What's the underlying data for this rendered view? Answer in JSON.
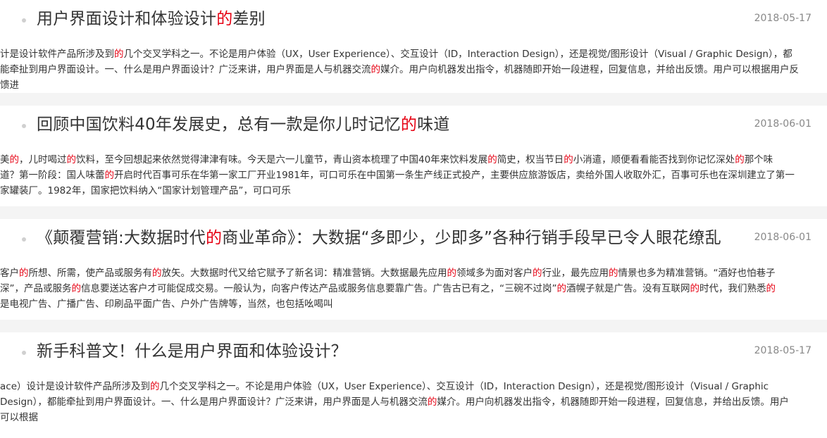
{
  "articles": [
    {
      "title_parts": [
        {
          "t": "用户界面设计和体验设计"
        },
        {
          "t": "的",
          "hl": true
        },
        {
          "t": "差别"
        }
      ],
      "date": "2018-05-17",
      "excerpt_lines": [
        [
          {
            "t": "计是设计软件产品所涉及到"
          },
          {
            "t": "的",
            "hl": true
          },
          {
            "t": "几个交叉学科之一。不论是用户体验（UX，User Experience）、交互设计（ID，Interaction Design），还是视觉/图形设计（Visual / Graphic Design），都"
          }
        ],
        [
          {
            "t": "能牵扯到用户界面设计。一、什么是用户界面设计？广泛来讲，用户界面是人与机器交流"
          },
          {
            "t": "的",
            "hl": true
          },
          {
            "t": "媒介。用户向机器发出指令，机器随即开始一段进程，回复信息，并给出反馈。用户可以根据用户反"
          }
        ],
        [
          {
            "t": "馈进"
          }
        ]
      ]
    },
    {
      "title_parts": [
        {
          "t": "回顾中国饮料40年发展史，总有一款是你儿时记忆"
        },
        {
          "t": "的",
          "hl": true
        },
        {
          "t": "味道"
        }
      ],
      "date": "2018-06-01",
      "excerpt_lines": [
        [
          {
            "t": "美"
          },
          {
            "t": "的",
            "hl": true
          },
          {
            "t": "，儿时喝过"
          },
          {
            "t": "的",
            "hl": true
          },
          {
            "t": "饮料，至今回想起来依然觉得津津有味。今天是六一儿童节，青山资本梳理了中国40年来饮料发展"
          },
          {
            "t": "的",
            "hl": true
          },
          {
            "t": "简史，权当节日"
          },
          {
            "t": "的",
            "hl": true
          },
          {
            "t": "小消遣，顺便看看能否找到你记忆深处"
          },
          {
            "t": "的",
            "hl": true
          },
          {
            "t": "那个味"
          }
        ],
        [
          {
            "t": "道？第一阶段：国人味蕾"
          },
          {
            "t": "的",
            "hl": true
          },
          {
            "t": "开启时代百事可乐在华第一家工厂开业1981年，可口可乐在中国第一条生产线正式投产，主要供应旅游饭店，卖给外国人收取外汇，百事可乐也在深圳建立了第一"
          }
        ],
        [
          {
            "t": "家罐装厂。1982年，国家把饮料纳入“国家计划管理产品”，可口可乐"
          }
        ]
      ]
    },
    {
      "title_parts": [
        {
          "t": "《颠覆营销:大数据时代"
        },
        {
          "t": "的",
          "hl": true
        },
        {
          "t": "商业革命》：大数据“多即少，少即多”各种行销手段早已令人眼花缭乱"
        }
      ],
      "date": "2018-06-01",
      "excerpt_lines": [
        [
          {
            "t": "客户"
          },
          {
            "t": "的",
            "hl": true
          },
          {
            "t": "所想、所需，使产品或服务有"
          },
          {
            "t": "的",
            "hl": true
          },
          {
            "t": "放矢。大数据时代又给它赋予了新名词：精准营销。大数据最先应用"
          },
          {
            "t": "的",
            "hl": true
          },
          {
            "t": "领域多为面对客户"
          },
          {
            "t": "的",
            "hl": true
          },
          {
            "t": "行业，最先应用"
          },
          {
            "t": "的",
            "hl": true
          },
          {
            "t": "情景也多为精准营销。“酒好也怕巷子"
          }
        ],
        [
          {
            "t": "深”，产品或服务"
          },
          {
            "t": "的",
            "hl": true
          },
          {
            "t": "信息要送达客户才可能促成交易。一般认为，向客户传达产品或服务信息要靠广告。广告古已有之，“三碗不过岗”"
          },
          {
            "t": "的",
            "hl": true
          },
          {
            "t": "酒幌子就是广告。没有互联网"
          },
          {
            "t": "的",
            "hl": true
          },
          {
            "t": "时代，我们熟悉"
          },
          {
            "t": "的",
            "hl": true
          }
        ],
        [
          {
            "t": "是电视广告、广播广告、印刷品平面广告、户外广告牌等，当然，也包括吆喝叫"
          }
        ]
      ]
    },
    {
      "title_parts": [
        {
          "t": "新手科普文！什么是用户界面和体验设计？"
        }
      ],
      "date": "2018-05-17",
      "excerpt_lines": [
        [
          {
            "t": "ace）设计是设计软件产品所涉及到"
          },
          {
            "t": "的",
            "hl": true
          },
          {
            "t": "几个交叉学科之一。不论是用户体验（UX，User Experience）、交互设计（ID，Interaction Design），还是视觉/图形设计（Visual / Graphic"
          }
        ],
        [
          {
            "t": "Design），都能牵扯到用户界面设计。一、什么是用户界面设计？广泛来讲，用户界面是人与机器交流"
          },
          {
            "t": "的",
            "hl": true
          },
          {
            "t": "媒介。用户向机器发出指令，机器随即开始一段进程，回复信息，并给出反馈。用户"
          }
        ],
        [
          {
            "t": "可以根据"
          }
        ]
      ]
    }
  ]
}
